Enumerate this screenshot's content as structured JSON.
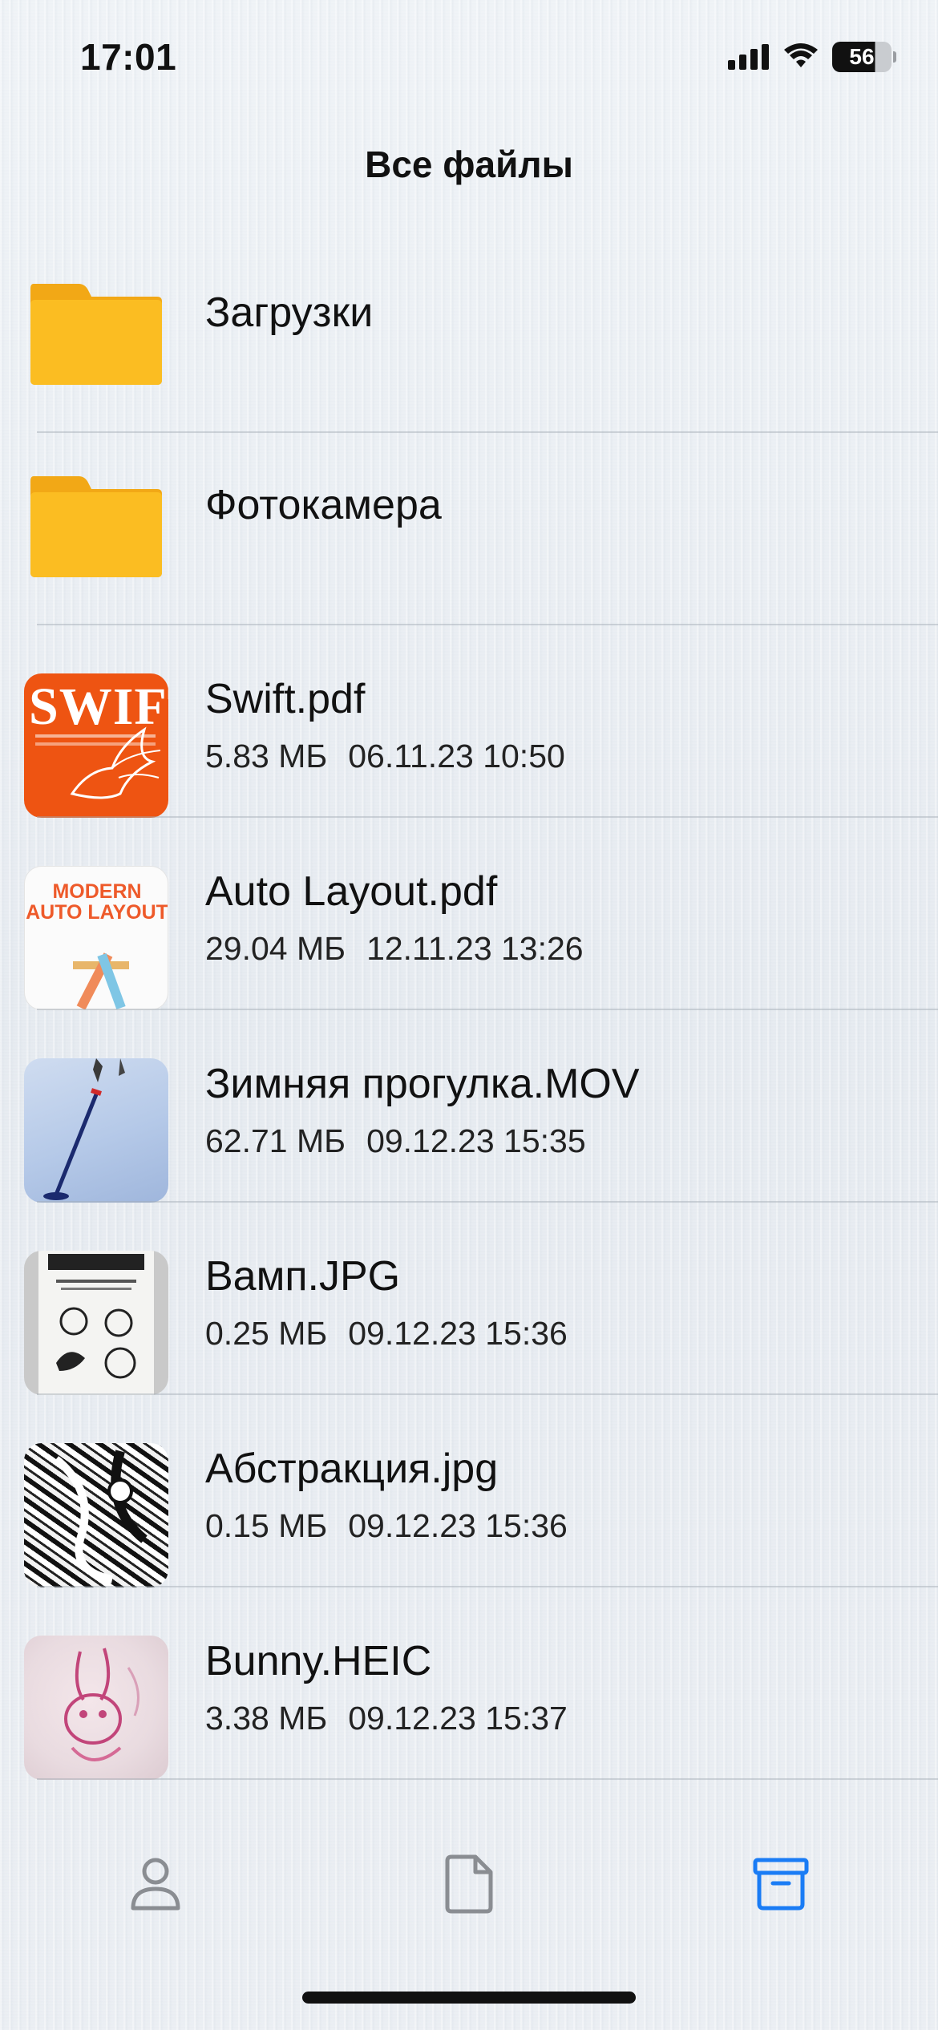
{
  "status_bar": {
    "time": "17:01",
    "battery_level": "56",
    "icons": [
      "cellular-signal-icon",
      "wifi-icon",
      "battery-icon"
    ]
  },
  "nav": {
    "title": "Все файлы"
  },
  "files": [
    {
      "type": "folder",
      "name": "Загрузки",
      "icon": "folder-icon"
    },
    {
      "type": "folder",
      "name": "Фотокамера",
      "icon": "folder-icon"
    },
    {
      "type": "file",
      "name": "Swift.pdf",
      "size": "5.83 МБ",
      "date": "06.11.23 10:50"
    },
    {
      "type": "file",
      "name": "Auto Layout.pdf",
      "size": "29.04 МБ",
      "date": "12.11.23 13:26"
    },
    {
      "type": "file",
      "name": "Зимняя прогулка.MOV",
      "size": "62.71 МБ",
      "date": "09.12.23 15:35"
    },
    {
      "type": "file",
      "name": "Вамп.JPG",
      "size": "0.25 МБ",
      "date": "09.12.23 15:36"
    },
    {
      "type": "file",
      "name": "Абстракция.jpg",
      "size": "0.15 МБ",
      "date": "09.12.23 15:36"
    },
    {
      "type": "file",
      "name": "Bunny.HEIC",
      "size": "3.38 МБ",
      "date": "09.12.23 15:37"
    }
  ],
  "thumbnails": {
    "swift_cover_text": "SWIFT",
    "autolayout_cover_text": "MODERN AUTO LAYOUT"
  },
  "tab_bar": {
    "tabs": [
      {
        "icon": "person-icon",
        "active": false
      },
      {
        "icon": "document-icon",
        "active": false
      },
      {
        "icon": "archive-box-icon",
        "active": true
      }
    ],
    "active_color": "#1a7cf5",
    "inactive_color": "#8a8d92"
  },
  "colors": {
    "folder": "#f9b81a",
    "swift_orange": "#ee5412"
  }
}
